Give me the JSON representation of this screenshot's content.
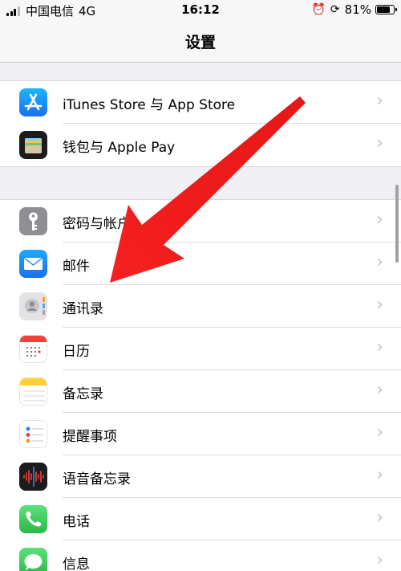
{
  "status_bar": {
    "carrier": "中国电信",
    "network": "4G",
    "time": "16:12",
    "battery_percent": "81%",
    "battery_level": 0.81,
    "icons": [
      "signal-icon",
      "alarm-icon",
      "orientation-lock-icon",
      "battery-icon"
    ]
  },
  "nav": {
    "title": "设置"
  },
  "groups": [
    {
      "items": [
        {
          "label": "iTunes Store 与 App Store",
          "icon": "app-store-icon",
          "color": "#1a8ef5"
        },
        {
          "label": "钱包与 Apple Pay",
          "icon": "wallet-icon",
          "color": "#1c1c1e"
        }
      ]
    },
    {
      "items": [
        {
          "label": "密码与帐户",
          "icon": "key-icon",
          "color": "#8e8e93"
        },
        {
          "label": "邮件",
          "icon": "mail-icon",
          "color": "#1b8cf4"
        },
        {
          "label": "通讯录",
          "icon": "contacts-icon",
          "color": "#d8d8da"
        },
        {
          "label": "日历",
          "icon": "calendar-icon",
          "color": "#ffffff"
        },
        {
          "label": "备忘录",
          "icon": "notes-icon",
          "color": "#fdd130"
        },
        {
          "label": "提醒事项",
          "icon": "reminders-icon",
          "color": "#ffffff"
        },
        {
          "label": "语音备忘录",
          "icon": "voice-memos-icon",
          "color": "#1c1c1e"
        },
        {
          "label": "电话",
          "icon": "phone-icon",
          "color": "#34c759"
        },
        {
          "label": "信息",
          "icon": "messages-icon",
          "color": "#34c759"
        }
      ]
    }
  ],
  "colors": {
    "background": "#efeff4",
    "annotation_arrow": "#f01010",
    "chevron": "#c4c4c7"
  }
}
